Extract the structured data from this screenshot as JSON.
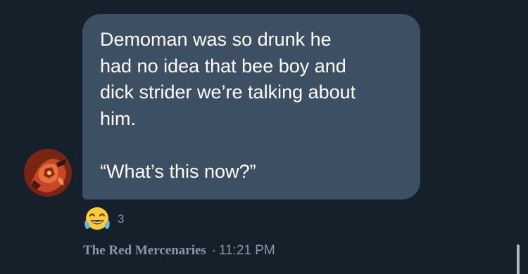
{
  "message": {
    "lines": [
      "Demoman was so drunk he",
      "had no idea that bee boy and",
      "dick strider we’re talking about",
      "him.",
      "",
      "“What’s this now?”"
    ]
  },
  "reaction": {
    "emoji": "😂",
    "icon": "tears-of-joy-emoji-icon",
    "count": "3"
  },
  "meta": {
    "sender": "The Red Mercenaries",
    "separator": "·",
    "time": "11:21 PM"
  },
  "colors": {
    "background": "#15202b",
    "bubble": "#3d4f62",
    "muted_text": "#8899a6"
  }
}
